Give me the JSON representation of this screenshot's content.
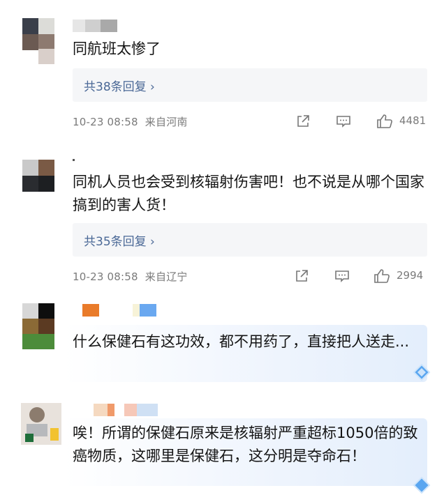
{
  "comments": [
    {
      "text": "同航班太惨了",
      "replies": "共38条回复 ›",
      "time": "10-23 08:58",
      "location": "来自河南",
      "likes": "4481"
    },
    {
      "text": "同机人员也会受到核辐射伤害吧！也不说是从哪个国家搞到的害人货！",
      "replies": "共35条回复 ›",
      "time": "10-23 08:58",
      "location": "来自辽宁",
      "likes": "2994"
    },
    {
      "text": "什么保健石有这功效，都不用药了，直接把人送走..."
    },
    {
      "text": "唉！所谓的保健石原来是核辐射严重超标1050倍的致癌物质，这哪里是保健石，这分明是夺命石！"
    }
  ],
  "icons": {
    "share": "share-icon",
    "comment": "comment-icon",
    "like": "thumbs-up-icon",
    "badge": "diamond-badge-icon"
  },
  "colors": {
    "link": "#4a6896",
    "meta": "#7a7a7a",
    "reply_bg": "#f5f6f8",
    "highlight": "#e3eefc"
  }
}
